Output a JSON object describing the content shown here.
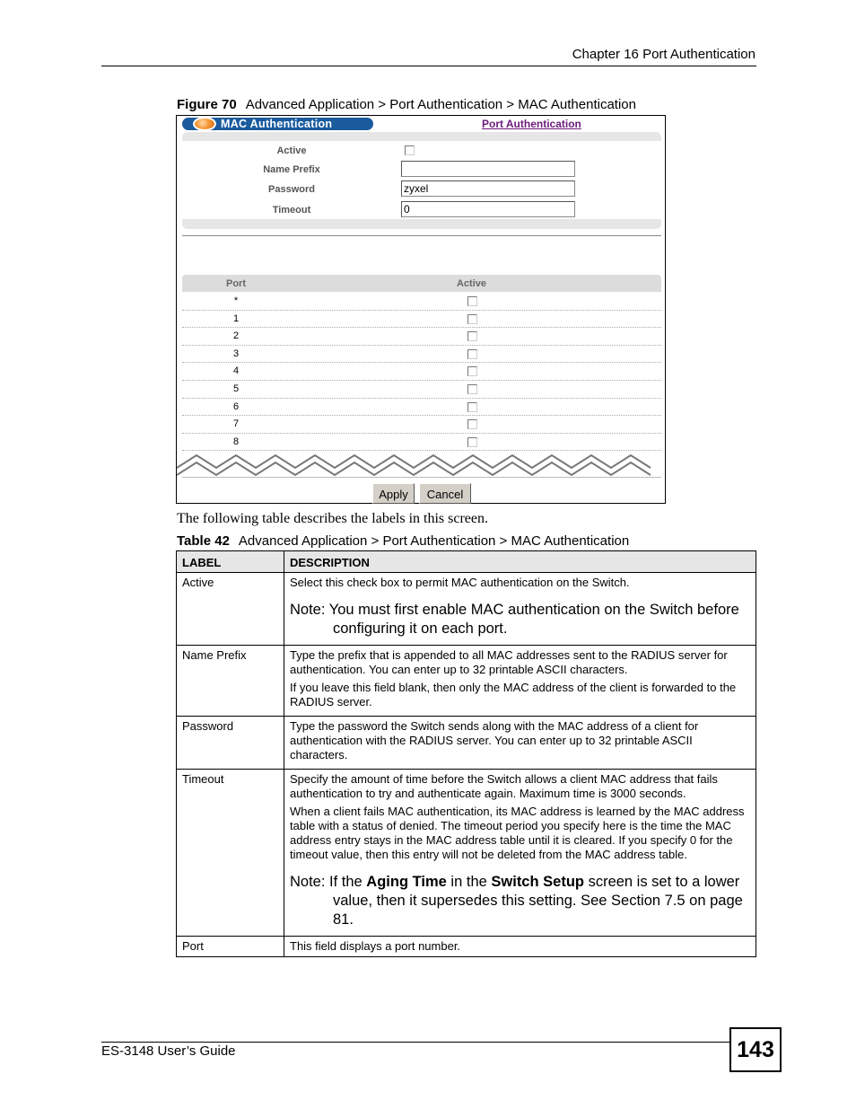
{
  "header": {
    "chapter": "Chapter 16 Port Authentication"
  },
  "figure": {
    "label": "Figure 70",
    "title": "Advanced Application > Port Authentication > MAC Authentication",
    "screen": {
      "title": "MAC Authentication",
      "link": "Port Authentication",
      "fields": [
        {
          "label": "Active",
          "type": "checkbox",
          "checked": false
        },
        {
          "label": "Name Prefix",
          "type": "text",
          "value": ""
        },
        {
          "label": "Password",
          "type": "text",
          "value": "zyxel"
        },
        {
          "label": "Timeout",
          "type": "text",
          "value": "0"
        }
      ],
      "port_table": {
        "headers": [
          "Port",
          "Active"
        ],
        "rows": [
          {
            "port": "*",
            "active": false
          },
          {
            "port": "1",
            "active": false
          },
          {
            "port": "2",
            "active": false
          },
          {
            "port": "3",
            "active": false
          },
          {
            "port": "4",
            "active": false
          },
          {
            "port": "5",
            "active": false
          },
          {
            "port": "6",
            "active": false
          },
          {
            "port": "7",
            "active": false
          },
          {
            "port": "8",
            "active": false
          }
        ]
      },
      "buttons": {
        "apply": "Apply",
        "cancel": "Cancel"
      }
    }
  },
  "intro_text": "The following table describes the labels in this screen.",
  "table": {
    "label": "Table 42",
    "title": "Advanced Application > Port Authentication > MAC Authentication",
    "headers": [
      "LABEL",
      "DESCRIPTION"
    ],
    "rows": [
      {
        "label": "Active",
        "paragraphs": [
          "Select this check box to permit MAC authentication on the Switch."
        ],
        "note": "Note: You must first enable MAC authentication on the Switch before configuring it on each port."
      },
      {
        "label": "Name Prefix",
        "paragraphs": [
          "Type the prefix that is appended to all MAC addresses sent to the RADIUS server for authentication. You can enter up to 32 printable ASCII characters.",
          "If you leave this field blank, then only the MAC address of the client is forwarded to the RADIUS server."
        ]
      },
      {
        "label": "Password",
        "paragraphs": [
          "Type the password the Switch sends along with the MAC address of a client for authentication with the RADIUS server. You can enter up to 32 printable ASCII characters."
        ]
      },
      {
        "label": "Timeout",
        "paragraphs": [
          "Specify the amount of time before the Switch allows a client MAC address that fails authentication to try and authenticate again. Maximum time is 3000 seconds.",
          "When a client fails MAC authentication, its MAC address is learned by the MAC address table with a status of denied. The timeout period you specify here is the time the MAC address entry stays in the MAC address table until it is cleared. If you specify 0 for the timeout value, then this entry will not be deleted from the MAC address table."
        ],
        "note_parts": {
          "prefix": "Note: If the ",
          "bold1": "Aging Time",
          "mid": " in the ",
          "bold2": "Switch Setup",
          "suffix": " screen is set to a lower value, then it supersedes this setting. See Section 7.5 on page 81."
        }
      },
      {
        "label": "Port",
        "paragraphs": [
          "This field displays a port number."
        ]
      }
    ]
  },
  "footer": {
    "guide": "ES-3148 User’s Guide",
    "page": "143"
  }
}
